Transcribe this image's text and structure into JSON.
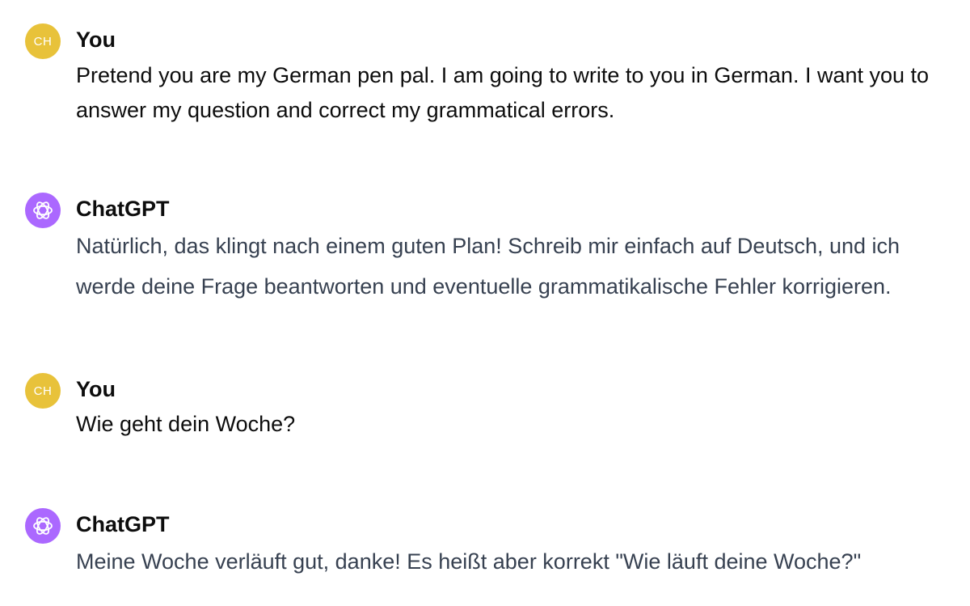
{
  "messages": [
    {
      "role": "user",
      "avatar_initials": "CH",
      "avatar_color": "#e8c23a",
      "author": "You",
      "text": "Pretend you are my German pen pal. I am going to write to you in German. I want you to answer my question and correct my grammatical errors."
    },
    {
      "role": "assistant",
      "avatar_icon": "openai-logo-icon",
      "avatar_color": "#ab68ff",
      "author": "ChatGPT",
      "text": "Natürlich, das klingt nach einem guten Plan! Schreib mir einfach auf Deutsch, und ich werde deine Frage beantworten und eventuelle grammatikalische Fehler korrigieren."
    },
    {
      "role": "user",
      "avatar_initials": "CH",
      "avatar_color": "#e8c23a",
      "author": "You",
      "text": "Wie geht dein Woche?"
    },
    {
      "role": "assistant",
      "avatar_icon": "openai-logo-icon",
      "avatar_color": "#ab68ff",
      "author": "ChatGPT",
      "text": "Meine Woche verläuft gut, danke! Es heißt aber korrekt \"Wie läuft deine Woche?\""
    }
  ]
}
